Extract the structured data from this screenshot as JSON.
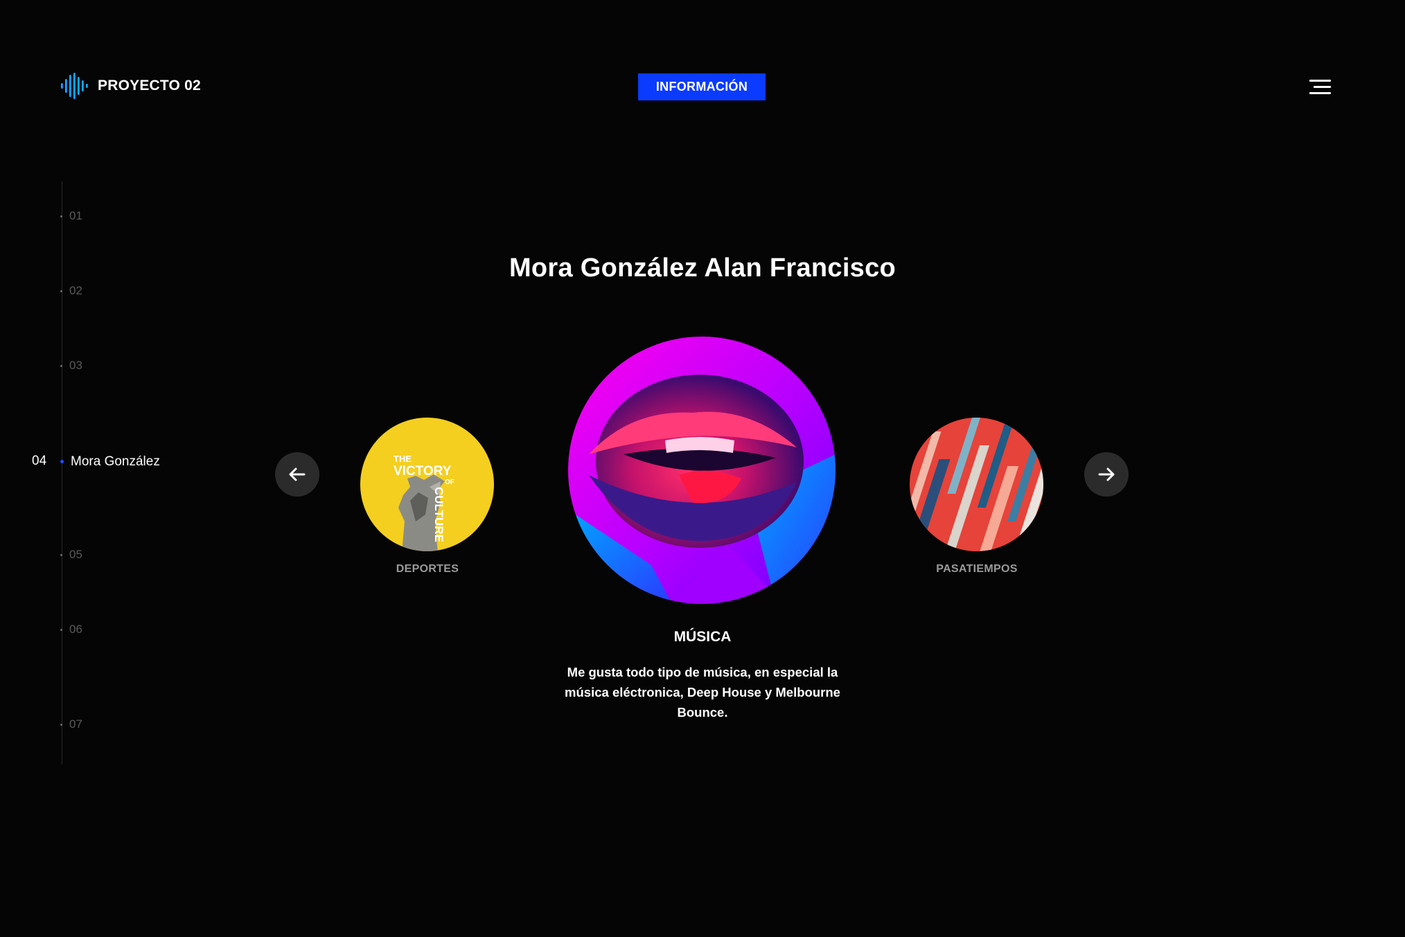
{
  "header": {
    "logo_text": "PROYECTO 02",
    "info_button": "INFORMACIÓN"
  },
  "timeline": {
    "items": [
      {
        "num": "01"
      },
      {
        "num": "02"
      },
      {
        "num": "03"
      },
      {
        "num": "05"
      },
      {
        "num": "06"
      },
      {
        "num": "07"
      }
    ],
    "active": {
      "num": "04",
      "name": "Mora González"
    }
  },
  "page_title": "Mora González Alan Francisco",
  "carousel": {
    "left_label": "DEPORTES",
    "right_label": "PASATIEMPOS",
    "center_label": "MÚSICA",
    "center_description": "Me gusta todo tipo de música, en especial la música eléctronica, Deep House y Melbourne Bounce.",
    "left_image_text": {
      "line1": "THE",
      "line2": "VICTORY",
      "line3": "OF",
      "line4": "CULTURE"
    }
  },
  "colors": {
    "accent": "#0a3bff",
    "background": "#050505",
    "deportes_bg": "#f4cf1f"
  },
  "icons": {
    "logo": "audio-wave-icon",
    "menu": "hamburger-icon",
    "prev": "arrow-left-icon",
    "next": "arrow-right-icon"
  }
}
